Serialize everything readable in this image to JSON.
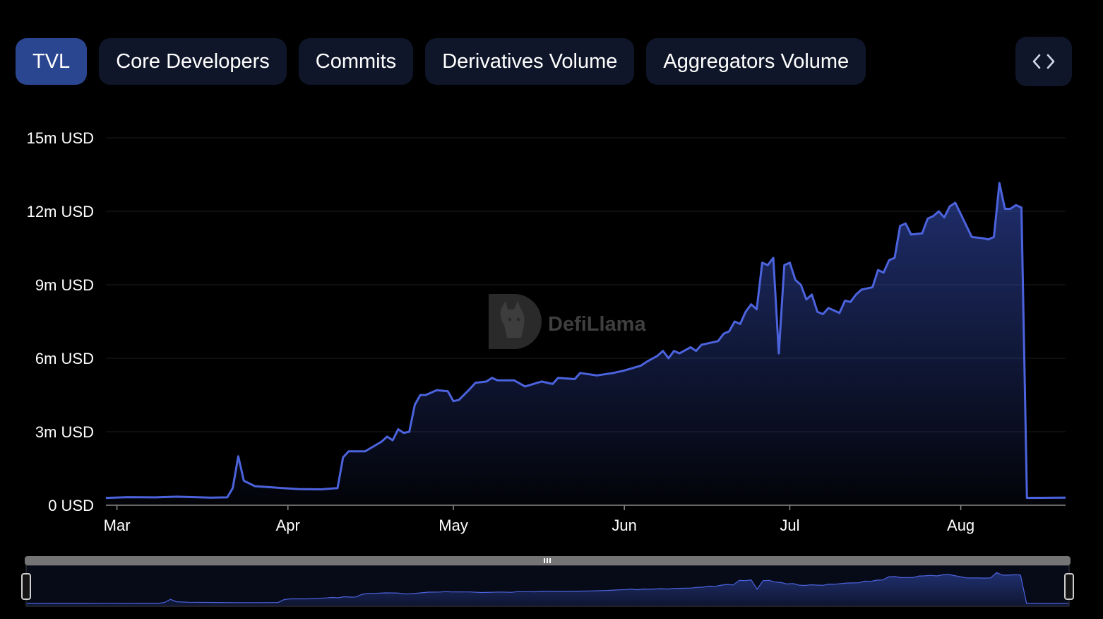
{
  "tabs": [
    {
      "label": "TVL",
      "active": true
    },
    {
      "label": "Core Developers",
      "active": false
    },
    {
      "label": "Commits",
      "active": false
    },
    {
      "label": "Derivatives Volume",
      "active": false
    },
    {
      "label": "Aggregators Volume",
      "active": false
    }
  ],
  "embed_button": {
    "icon": "code-brackets-icon"
  },
  "watermark": {
    "text": "DefiLlama",
    "icon": "defillama-logo-icon"
  },
  "colors": {
    "line": "#4c63de",
    "active_tab": "#2b4691",
    "tab": "#0f1629",
    "grid": "#1c1c1c"
  },
  "chart_data": {
    "type": "area",
    "ylim": [
      0,
      15000000
    ],
    "yticks": [
      {
        "value": 0,
        "label": "0 USD"
      },
      {
        "value": 3000000,
        "label": "3m USD"
      },
      {
        "value": 6000000,
        "label": "6m USD"
      },
      {
        "value": 9000000,
        "label": "9m USD"
      },
      {
        "value": 12000000,
        "label": "12m USD"
      },
      {
        "value": 15000000,
        "label": "15m USD"
      }
    ],
    "xlim": [
      "2023-02-27",
      "2023-08-20"
    ],
    "xticks": [
      {
        "date": "2023-03-01",
        "label": "Mar"
      },
      {
        "date": "2023-04-01",
        "label": "Apr"
      },
      {
        "date": "2023-05-01",
        "label": "May"
      },
      {
        "date": "2023-06-01",
        "label": "Jun"
      },
      {
        "date": "2023-07-01",
        "label": "Jul"
      },
      {
        "date": "2023-08-01",
        "label": "Aug"
      }
    ],
    "grid": true,
    "series": [
      {
        "x": [
          "2023-02-27",
          "2023-03-03",
          "2023-03-08",
          "2023-03-12",
          "2023-03-18",
          "2023-03-21",
          "2023-03-22",
          "2023-03-23",
          "2023-03-24",
          "2023-03-26",
          "2023-03-31",
          "2023-04-03",
          "2023-04-07",
          "2023-04-10",
          "2023-04-11",
          "2023-04-12",
          "2023-04-15",
          "2023-04-18",
          "2023-04-19",
          "2023-04-20",
          "2023-04-21",
          "2023-04-22",
          "2023-04-23",
          "2023-04-24",
          "2023-04-25",
          "2023-04-26",
          "2023-04-28",
          "2023-04-30",
          "2023-05-01",
          "2023-05-02",
          "2023-05-04",
          "2023-05-05",
          "2023-05-07",
          "2023-05-08",
          "2023-05-09",
          "2023-05-12",
          "2023-05-14",
          "2023-05-17",
          "2023-05-19",
          "2023-05-20",
          "2023-05-23",
          "2023-05-24",
          "2023-05-27",
          "2023-05-30",
          "2023-06-01",
          "2023-06-04",
          "2023-06-05",
          "2023-06-07",
          "2023-06-08",
          "2023-06-09",
          "2023-06-10",
          "2023-06-11",
          "2023-06-13",
          "2023-06-14",
          "2023-06-15",
          "2023-06-16",
          "2023-06-18",
          "2023-06-19",
          "2023-06-20",
          "2023-06-21",
          "2023-06-22",
          "2023-06-23",
          "2023-06-24",
          "2023-06-25",
          "2023-06-26",
          "2023-06-27",
          "2023-06-28",
          "2023-06-29",
          "2023-06-30",
          "2023-07-01",
          "2023-07-02",
          "2023-07-03",
          "2023-07-04",
          "2023-07-05",
          "2023-07-06",
          "2023-07-07",
          "2023-07-08",
          "2023-07-10",
          "2023-07-11",
          "2023-07-12",
          "2023-07-13",
          "2023-07-14",
          "2023-07-15",
          "2023-07-16",
          "2023-07-17",
          "2023-07-18",
          "2023-07-19",
          "2023-07-20",
          "2023-07-21",
          "2023-07-22",
          "2023-07-23",
          "2023-07-25",
          "2023-07-26",
          "2023-07-27",
          "2023-07-28",
          "2023-07-29",
          "2023-07-30",
          "2023-07-31",
          "2023-08-03",
          "2023-08-05",
          "2023-08-06",
          "2023-08-07",
          "2023-08-08",
          "2023-08-09",
          "2023-08-10",
          "2023-08-11",
          "2023-08-12",
          "2023-08-13",
          "2023-08-20"
        ],
        "values": [
          300000,
          330000,
          320000,
          350000,
          310000,
          320000,
          700000,
          2000000,
          1000000,
          780000,
          700000,
          660000,
          650000,
          700000,
          1950000,
          2200000,
          2200000,
          2600000,
          2800000,
          2650000,
          3100000,
          2950000,
          3000000,
          4100000,
          4500000,
          4500000,
          4700000,
          4650000,
          4250000,
          4300000,
          4750000,
          5000000,
          5050000,
          5200000,
          5100000,
          5100000,
          4850000,
          5050000,
          4950000,
          5200000,
          5150000,
          5400000,
          5300000,
          5400000,
          5500000,
          5700000,
          5850000,
          6100000,
          6300000,
          6000000,
          6300000,
          6200000,
          6450000,
          6300000,
          6550000,
          6600000,
          6700000,
          7000000,
          7100000,
          7500000,
          7400000,
          7900000,
          8200000,
          8000000,
          9900000,
          9800000,
          10100000,
          6200000,
          9800000,
          9900000,
          9200000,
          9000000,
          8400000,
          8600000,
          7900000,
          7800000,
          8050000,
          7850000,
          8350000,
          8300000,
          8600000,
          8800000,
          8850000,
          8900000,
          9600000,
          9500000,
          10000000,
          10100000,
          11400000,
          11500000,
          11050000,
          11100000,
          11700000,
          11800000,
          12000000,
          11750000,
          12200000,
          12350000,
          10950000,
          10900000,
          10850000,
          10950000,
          13150000,
          12100000,
          12100000,
          12250000,
          12150000,
          300000,
          310000
        ]
      }
    ]
  }
}
